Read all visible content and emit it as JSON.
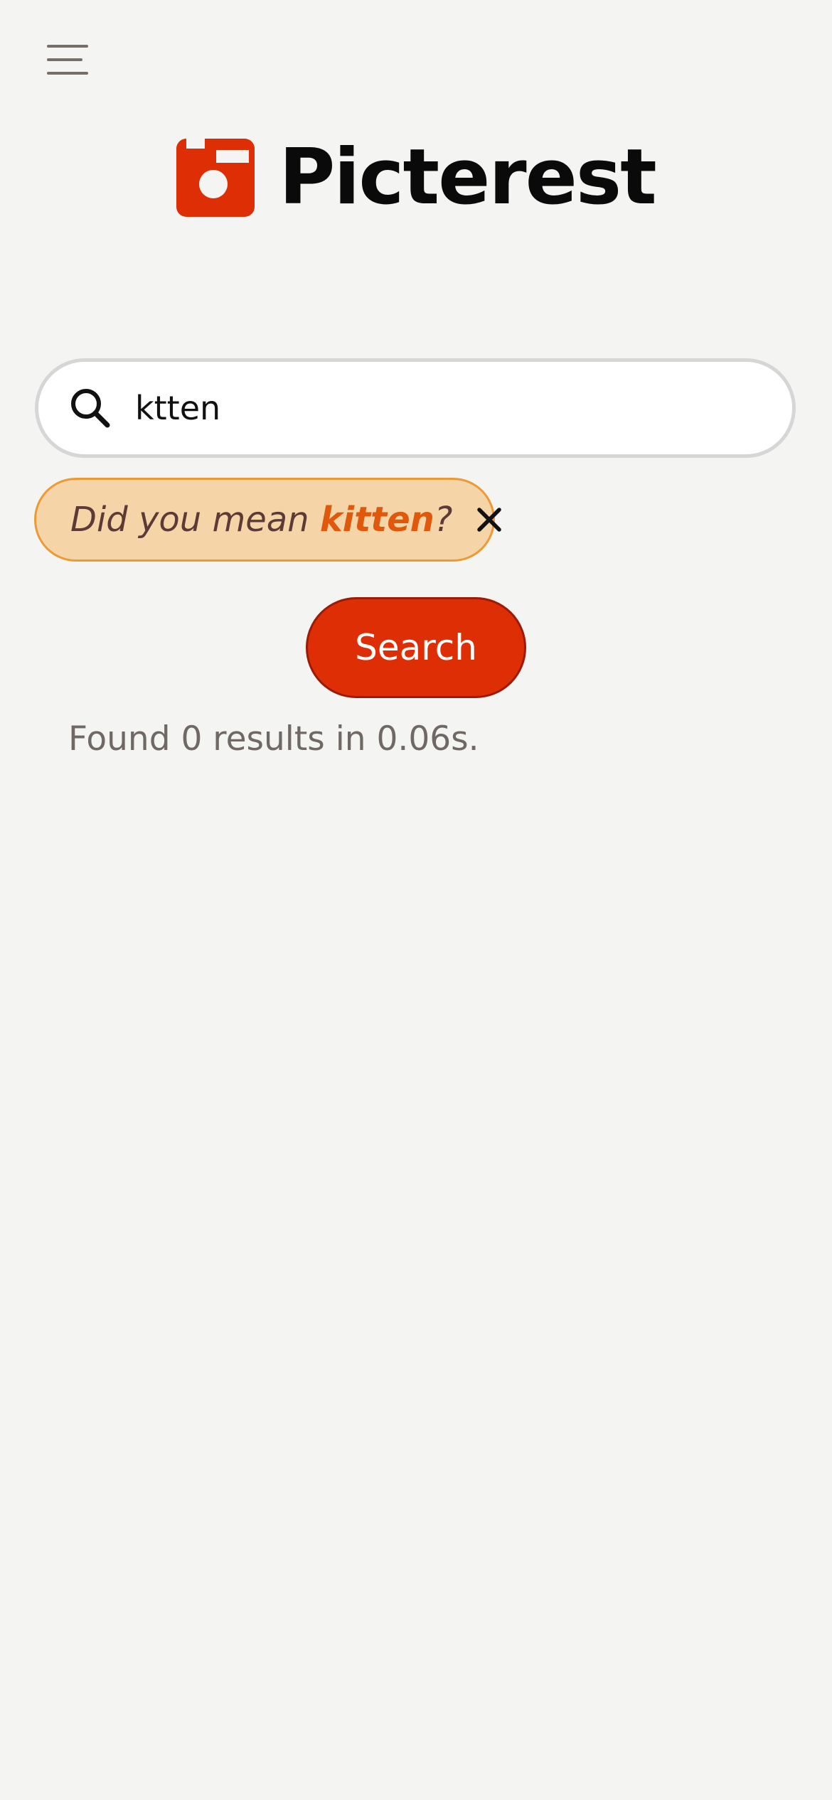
{
  "header": {
    "menu_icon": "hamburger-menu-icon",
    "logo_icon": "camera-icon",
    "brand_name": "Picterest",
    "brand_color": "#de2e05"
  },
  "search": {
    "icon": "search-icon",
    "value": "ktten",
    "button_label": "Search"
  },
  "suggestion": {
    "prefix": "Did you mean ",
    "term": "kitten",
    "suffix": "?",
    "dismiss_icon": "close-icon",
    "term_color": "#e0580c"
  },
  "results": {
    "status": "Found 0 results in 0.06s."
  }
}
